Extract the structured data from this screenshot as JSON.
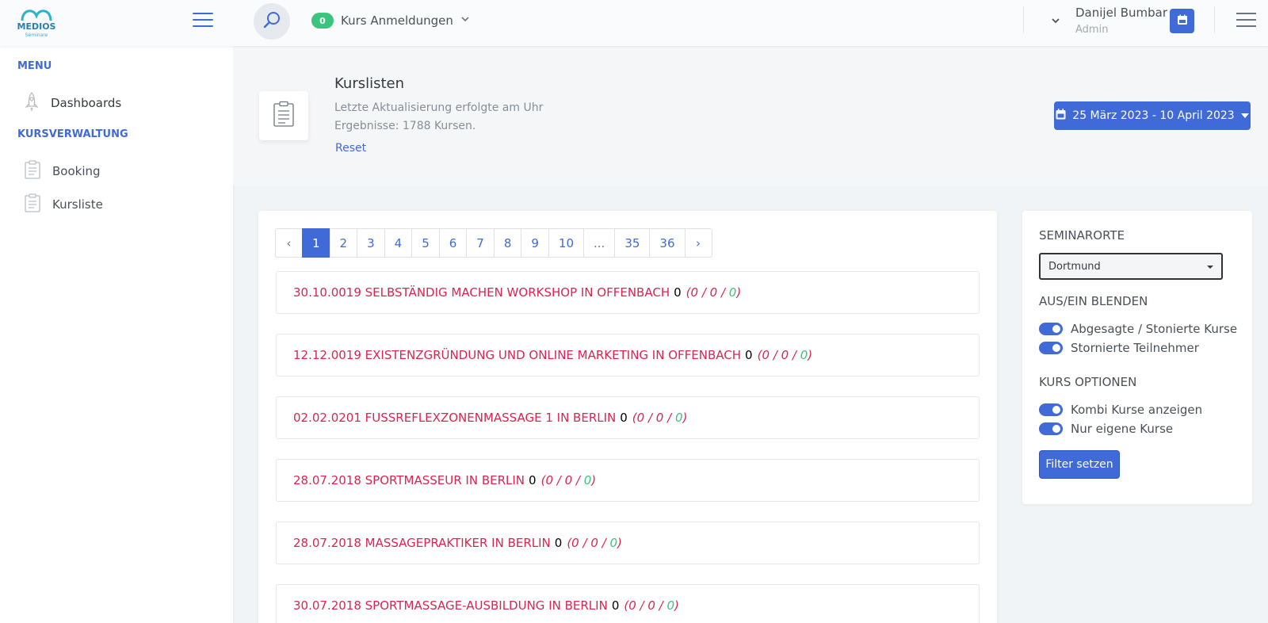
{
  "header": {
    "logo_text": "MEDIOS",
    "logo_sub": "Seminare",
    "kurs_anmeldungen_count": "0",
    "kurs_anmeldungen_label": "Kurs Anmeldungen",
    "user_name": "Danijel Bumbar",
    "user_role": "Admin"
  },
  "sidebar": {
    "menu_heading": "MENU",
    "dashboards": "Dashboards",
    "kursverwaltung_heading": "KURSVERWALTUNG",
    "booking": "Booking",
    "kursliste": "Kursliste"
  },
  "title": {
    "heading": "Kurslisten",
    "updated": "Letzte Aktualisierung erfolgte am Uhr",
    "results": "Ergebnisse: 1788 Kursen.",
    "reset": "Reset",
    "date_range": "25 März 2023 - 10 April 2023"
  },
  "pagination": [
    "‹",
    "1",
    "2",
    "3",
    "4",
    "5",
    "6",
    "7",
    "8",
    "9",
    "10",
    "...",
    "35",
    "36",
    "›"
  ],
  "courses": [
    {
      "title": "30.10.0019 Selbständig machen Workshop in Offenbach",
      "count": "0",
      "a": "0",
      "b": "0",
      "c": "0"
    },
    {
      "title": "12.12.0019 Existenzgründung und Online Marketing in Offenbach",
      "count": "0",
      "a": "0",
      "b": "0",
      "c": "0"
    },
    {
      "title": "02.02.0201 Fussreflexzonenmassage 1 in Berlin",
      "count": "0",
      "a": "0",
      "b": "0",
      "c": "0"
    },
    {
      "title": "28.07.2018 Sportmasseur in Berlin",
      "count": "0",
      "a": "0",
      "b": "0",
      "c": "0"
    },
    {
      "title": "28.07.2018 Massagepraktiker in Berlin",
      "count": "0",
      "a": "0",
      "b": "0",
      "c": "0"
    },
    {
      "title": "30.07.2018 Sportmassage-Ausbildung in Berlin",
      "count": "0",
      "a": "0",
      "b": "0",
      "c": "0"
    }
  ],
  "filter": {
    "seminarorte_heading": "SEMINARORTE",
    "seminarort_selected": "Dortmund",
    "ausein_heading": "AUS/EIN BLENDEN",
    "toggle_abgesagte": "Abgesagte / Stonierte Kurse",
    "toggle_stornierte": "Stornierte Teilnehmer",
    "kurs_optionen_heading": "KURS OPTIONEN",
    "toggle_kombi": "Kombi Kurse anzeigen",
    "toggle_eigene": "Nur eigene Kurse",
    "filter_button": "Filter setzen"
  },
  "colors": {
    "primary": "#3f6ad8",
    "danger": "#d92550",
    "success": "#3ac47d"
  }
}
